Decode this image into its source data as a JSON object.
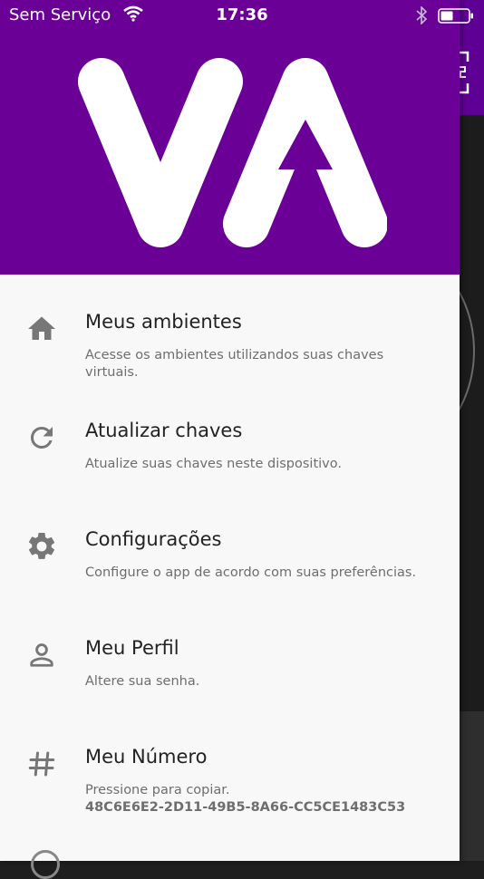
{
  "status_bar": {
    "carrier": "Sem Serviço",
    "time": "17:36",
    "wifi_icon": "wifi-icon",
    "bluetooth_icon": "bluetooth-icon",
    "battery_icon": "battery-icon"
  },
  "drawer": {
    "logo_text": "VA",
    "header_color": "#6a0095",
    "items": [
      {
        "icon": "home-icon",
        "title": "Meus ambientes",
        "description": "Acesse os ambientes utilizandos suas chaves virtuais."
      },
      {
        "icon": "refresh-icon",
        "title": "Atualizar chaves",
        "description": "Atualize suas chaves neste dispositivo."
      },
      {
        "icon": "gear-icon",
        "title": "Configurações",
        "description": "Configure o app de acordo com suas preferências."
      },
      {
        "icon": "person-icon",
        "title": "Meu Perfil",
        "description": "Altere sua senha."
      },
      {
        "icon": "hash-icon",
        "title": "Meu Número",
        "description": "Pressione para copiar.",
        "code": "48C6E6E2-2D11-49B5-8A66-CC5CE1483C53"
      }
    ]
  }
}
